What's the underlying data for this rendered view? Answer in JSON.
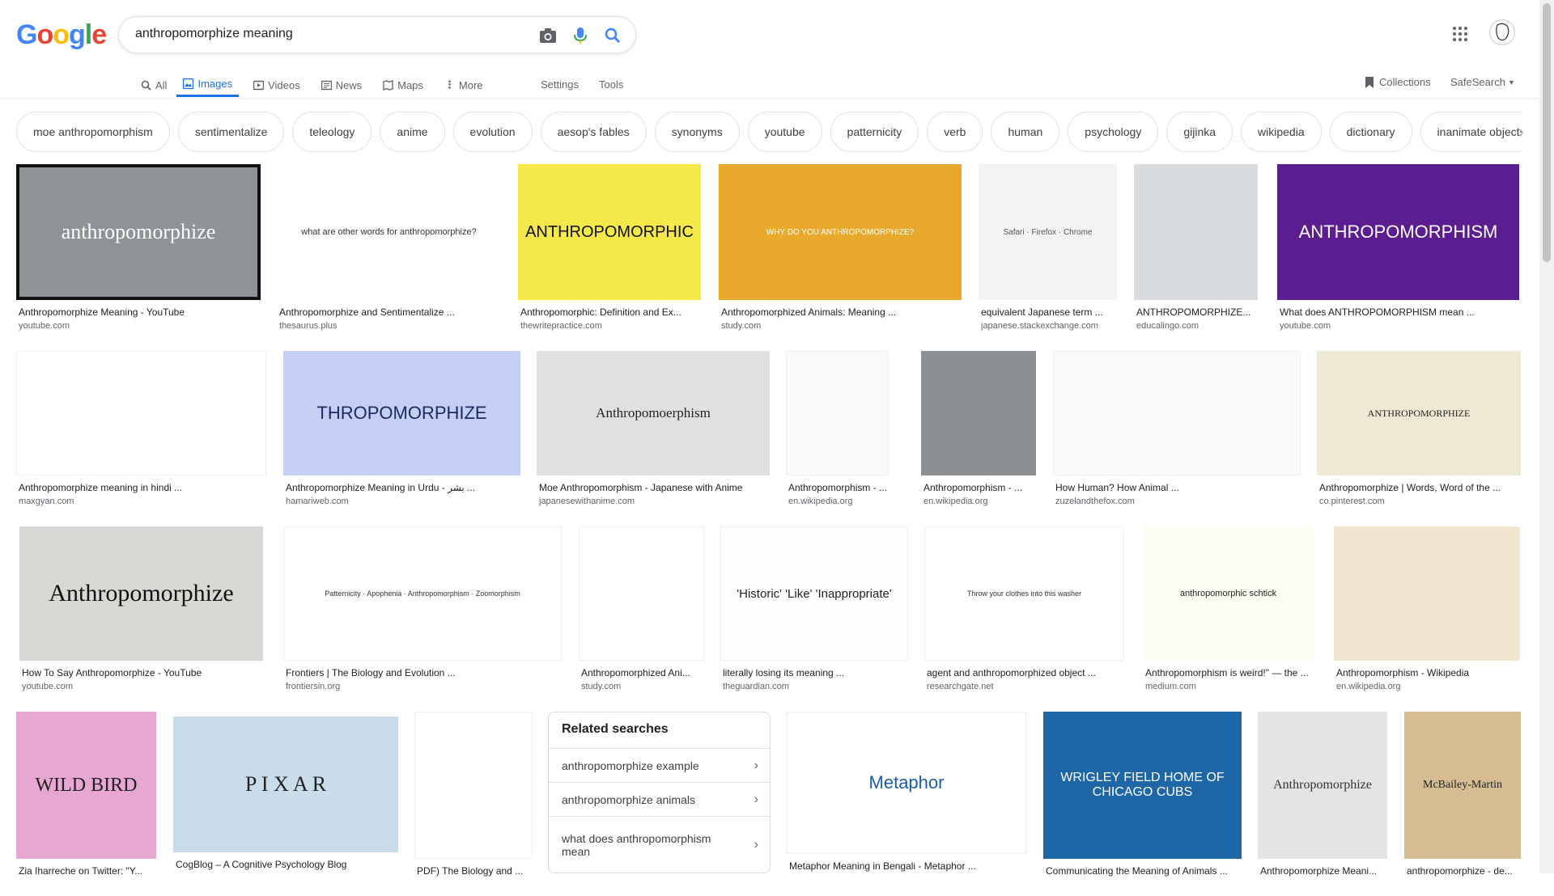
{
  "logo": "Google",
  "search": {
    "query": "anthropomorphize meaning"
  },
  "tabs": {
    "all": "All",
    "images": "Images",
    "videos": "Videos",
    "news": "News",
    "maps": "Maps",
    "more": "More",
    "settings": "Settings",
    "tools": "Tools"
  },
  "header_right": {
    "collections": "Collections",
    "safesearch": "SafeSearch"
  },
  "chips": [
    "moe anthropomorphism",
    "sentimentalize",
    "teleology",
    "anime",
    "evolution",
    "aesop's fables",
    "synonyms",
    "youtube",
    "patternicity",
    "verb",
    "human",
    "psychology",
    "gijinka",
    "wikipedia",
    "dictionary",
    "inanimate objects"
  ],
  "results": [
    {
      "title": "Anthropomorphize Meaning - YouTube",
      "source": "youtube.com",
      "thumb_text": "anthropomorphize"
    },
    {
      "title": "Anthropomorphize and Sentimentalize ...",
      "source": "thesaurus.plus",
      "thumb_text": "what are other words for anthropomorphize?"
    },
    {
      "title": "Anthropomorphic: Definition and Ex...",
      "source": "thewritepractice.com",
      "thumb_text": "ANTHROPOMORPHIC"
    },
    {
      "title": "Anthropomorphized Animals: Meaning ...",
      "source": "study.com",
      "thumb_text": "WHY DO YOU ANTHROPOMORPHIZE?"
    },
    {
      "title": "equivalent Japanese term ...",
      "source": "japanese.stackexchange.com",
      "thumb_text": "Safari · Firefox · Chrome"
    },
    {
      "title": "ANTHROPOMORPHIZE...",
      "source": "educalingo.com",
      "thumb_text": ""
    },
    {
      "title": "What does ANTHROPOMORPHISM mean ...",
      "source": "youtube.com",
      "thumb_text": "ANTHROPOMORPHISM"
    },
    {
      "title": "Anthropomorphize meaning in hindi ...",
      "source": "maxgyan.com",
      "thumb_text": ""
    },
    {
      "title": "Anthropomorphize Meaning in Urdu - بشر ...",
      "source": "hamariweb.com",
      "thumb_text": "THROPOMORPHIZE"
    },
    {
      "title": "Moe Anthropomorphism - Japanese with Anime",
      "source": "japanesewithanime.com",
      "thumb_text": "Anthropomoerphism"
    },
    {
      "title": "Anthropomorphism - ...",
      "source": "en.wikipedia.org",
      "thumb_text": ""
    },
    {
      "title": "Anthropomorphism - ...",
      "source": "en.wikipedia.org",
      "thumb_text": ""
    },
    {
      "title": "How Human? How Animal ...",
      "source": "zuzelandthefox.com",
      "thumb_text": ""
    },
    {
      "title": "Anthropomorphize | Words, Word of the ...",
      "source": "co.pinterest.com",
      "thumb_text": "ANTHROPOMORPHIZE"
    },
    {
      "title": "How To Say Anthropomorphize - YouTube",
      "source": "youtube.com",
      "thumb_text": "Anthropomorphize"
    },
    {
      "title": "Frontiers | The Biology and Evolution ...",
      "source": "frontiersin.org",
      "thumb_text": "Patternicity · Apophenia · Anthropomorphism · Zoomorphism"
    },
    {
      "title": "Anthropomorphized Ani...",
      "source": "study.com",
      "thumb_text": ""
    },
    {
      "title": "literally losing its meaning ...",
      "source": "theguardian.com",
      "thumb_text": "'Historic' 'Like' 'Inappropriate'"
    },
    {
      "title": "agent and anthropomorphized object ...",
      "source": "researchgate.net",
      "thumb_text": "Throw your clothes into this washer"
    },
    {
      "title": "Anthropomorphism is weird!\" — the ...",
      "source": "medium.com",
      "thumb_text": "anthropomorphic schtick"
    },
    {
      "title": "Anthropomorphism - Wikipedia",
      "source": "en.wikipedia.org",
      "thumb_text": ""
    },
    {
      "title": "Zia Iharreche on Twitter: \"Y...",
      "source": "",
      "thumb_text": "WILD BIRD"
    },
    {
      "title": "CogBlog – A Cognitive Psychology Blog",
      "source": "",
      "thumb_text": "P I X A R"
    },
    {
      "title": "PDF) The Biology and ...",
      "source": "",
      "thumb_text": ""
    },
    {
      "title": "Metaphor Meaning in Bengali - Metaphor ...",
      "source": "",
      "thumb_text": "Metaphor"
    },
    {
      "title": "Communicating the Meaning of Animals ...",
      "source": "",
      "thumb_text": "WRIGLEY FIELD HOME OF CHICAGO CUBS"
    },
    {
      "title": "Anthropomorphize Meani...",
      "source": "",
      "thumb_text": "Anthropomorphize"
    },
    {
      "title": "anthropomorphize - de...",
      "source": "",
      "thumb_text": "McBailey-Martin"
    }
  ],
  "related": {
    "title": "Related searches",
    "items": [
      "anthropomorphize example",
      "anthropomorphize animals",
      "what does anthropomorphism mean"
    ]
  },
  "colors": {
    "accent": "#1a73e8",
    "google_blue": "#4285f4",
    "google_red": "#ea4335",
    "google_yellow": "#fbbc05",
    "google_green": "#34a853"
  }
}
